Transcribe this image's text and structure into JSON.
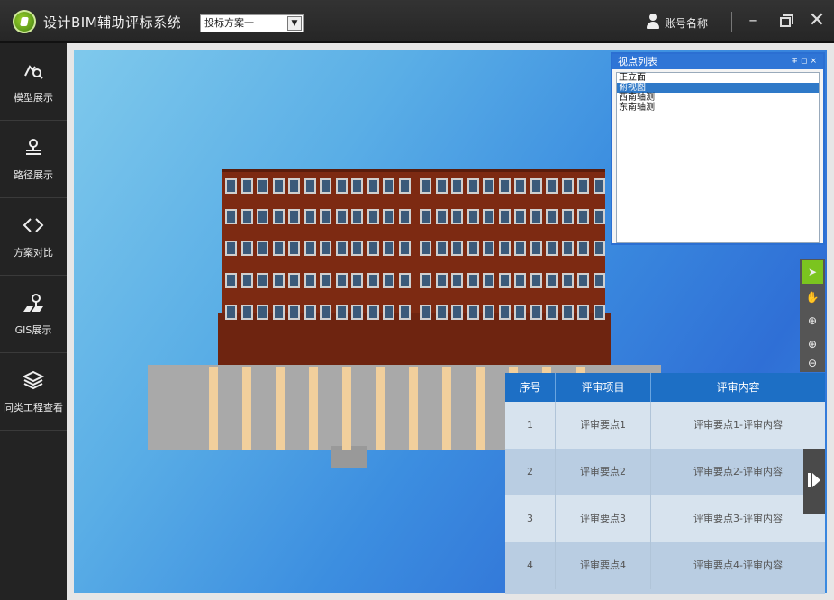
{
  "titlebar": {
    "app_title": "设计BIM辅助评标系统",
    "scheme_selected": "投标方案一",
    "user_name": "账号名称"
  },
  "sidebar": {
    "items": [
      {
        "label": "模型展示",
        "icon": "model-view-icon"
      },
      {
        "label": "路径展示",
        "icon": "route-icon"
      },
      {
        "label": "方案对比",
        "icon": "compare-icon"
      },
      {
        "label": "GIS展示",
        "icon": "gis-map-pin-icon"
      },
      {
        "label": "同类工程查看",
        "icon": "layers-icon"
      }
    ]
  },
  "view_panel": {
    "title": "视点列表",
    "items": [
      "正立面",
      "俯视图",
      "西南轴测",
      "东南轴测"
    ],
    "selected_index": 1
  },
  "toolbar": {
    "tools": [
      "select-pointer-icon",
      "pan-hand-icon",
      "orbit-icon",
      "zoom-in-icon",
      "zoom-out-icon"
    ]
  },
  "review_table": {
    "headers": [
      "序号",
      "评审项目",
      "评审内容"
    ],
    "rows": [
      [
        "1",
        "评审要点1",
        "评审要点1-评审内容"
      ],
      [
        "2",
        "评审要点2",
        "评审要点2-评审内容"
      ],
      [
        "3",
        "评审要点3",
        "评审要点3-评审内容"
      ],
      [
        "4",
        "评审要点4",
        "评审要点4-评审内容"
      ]
    ]
  },
  "colors": {
    "accent_green": "#7bc41f",
    "header_blue": "#1d6fc5",
    "building_brick": "#7d2a12"
  }
}
